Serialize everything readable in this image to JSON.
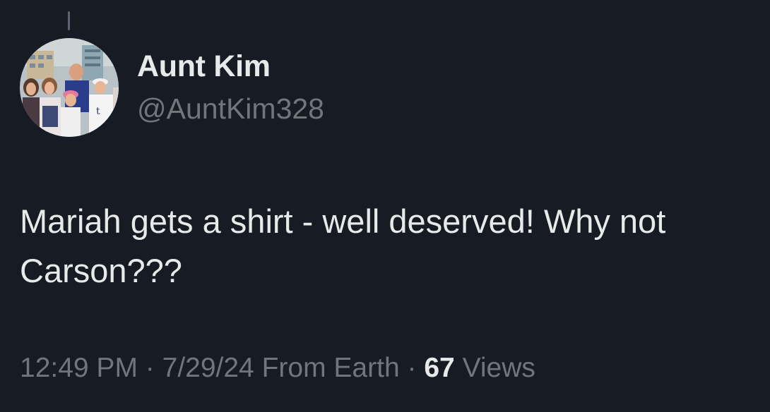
{
  "user": {
    "display_name": "Aunt Kim",
    "handle": "@AuntKim328",
    "avatar_icon": "profile-photo"
  },
  "tweet": {
    "text": "Mariah gets a shirt - well deserved! Why not Carson???"
  },
  "meta": {
    "time": "12:49 PM",
    "separator": "·",
    "date": "7/29/24",
    "source": "From Earth",
    "views_count": "67",
    "views_label": "Views"
  },
  "colors": {
    "background": "#161b24",
    "primary_text": "#e7e9ea",
    "secondary_text": "#71767b"
  }
}
